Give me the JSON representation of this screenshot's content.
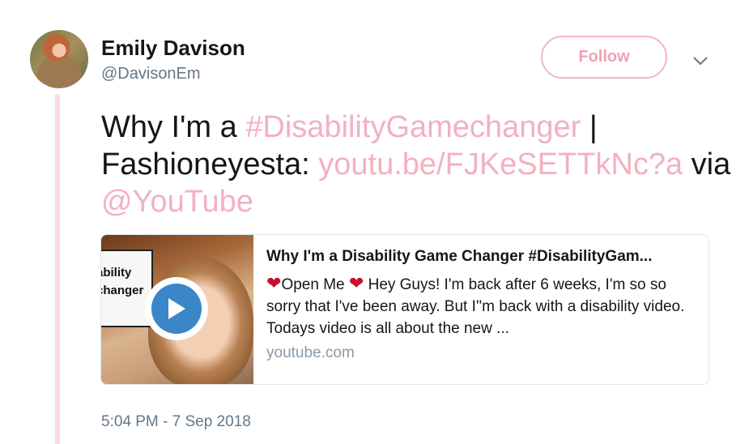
{
  "author": {
    "name": "Emily Davison",
    "handle": "@DavisonEm"
  },
  "follow_label": "Follow",
  "caret_icon": "chevron-down-icon",
  "tweet": {
    "text_1": "Why I'm a ",
    "hashtag": "#DisabilityGamechanger",
    "text_2": " | Fashioneyesta: ",
    "link": "youtu.be/FJKeSETTkNc?a",
    "text_3": " via ",
    "mention": "@YouTube"
  },
  "card": {
    "title": "Why I'm a Disability Game Changer #DisabilityGam...",
    "thumb_sign_line1": "ability",
    "thumb_sign_line2": "changer",
    "desc_1": "Open Me ",
    "desc_2": " Hey Guys! I'm back after 6 weeks, I'm so so sorry that I've been away. But I''m back with a disability video. Todays video is all about the new ...",
    "heart_glyph": "❤",
    "domain": "youtube.com"
  },
  "timestamp": "5:04 PM - 7 Sep 2018",
  "colors": {
    "link": "#f2b1c0",
    "follow_border": "#f2b5c2",
    "thread_line": "#f9dde3",
    "play": "#3a86c8"
  }
}
